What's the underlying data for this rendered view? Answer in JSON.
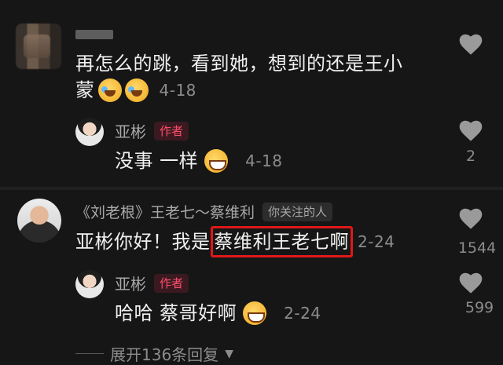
{
  "comment1": {
    "text_line1": "再怎么的跳，看到她，想到的还是王小",
    "text_line2": "蒙",
    "date": "4-18"
  },
  "reply1": {
    "name": "亚彬",
    "badge": "作者",
    "text": "没事 一样",
    "date": "4-18",
    "like_count": "2"
  },
  "comment2": {
    "name": "《刘老根》王老七～蔡维利",
    "follow_badge": "你关注的人",
    "text_before": "亚彬你好！我是",
    "text_highlight": "蔡维利王老七啊",
    "date": "2-24",
    "like_count": "1544"
  },
  "reply2": {
    "name": "亚彬",
    "badge": "作者",
    "text": "哈哈 蔡哥好啊",
    "date": "2-24",
    "like_count": "599"
  },
  "expand": {
    "label": "展开136条回复"
  },
  "colors": {
    "background": "#161616",
    "author_badge": "#ff4d6a",
    "highlight_border": "#e01818"
  }
}
